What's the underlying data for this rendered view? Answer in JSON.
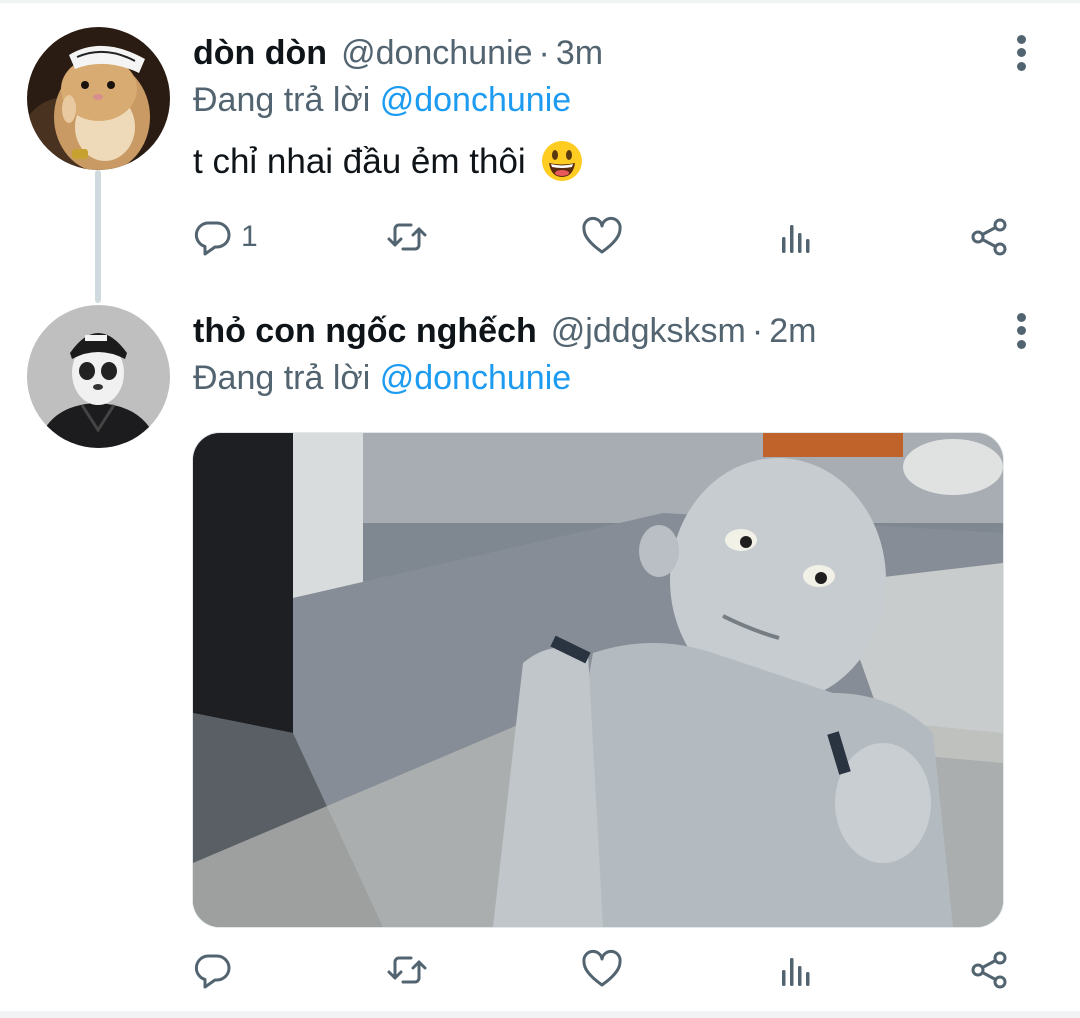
{
  "tweets": [
    {
      "name": "dòn dòn",
      "handle": "@donchunie",
      "separator": "·",
      "time": "3m",
      "replying_prefix": "Đang trả lời",
      "replying_to": "@donchunie",
      "text": "t chỉ nhai đầu ẻm thôi",
      "emoji": "grinning-face",
      "reply_count": "1"
    },
    {
      "name": "thỏ con ngốc nghếch",
      "handle": "@jddgksksm",
      "separator": "·",
      "time": "2m",
      "replying_prefix": "Đang trả lời",
      "replying_to": "@donchunie",
      "media": "photo of a gray humanoid child robot looking upward",
      "reply_count": ""
    }
  ],
  "icons": [
    "reply-icon",
    "retweet-icon",
    "like-icon",
    "views-icon",
    "share-icon",
    "more-options-icon"
  ],
  "colors": {
    "accent": "#1d9bf0",
    "secondary_text": "#536471",
    "primary_text": "#0f1419"
  }
}
